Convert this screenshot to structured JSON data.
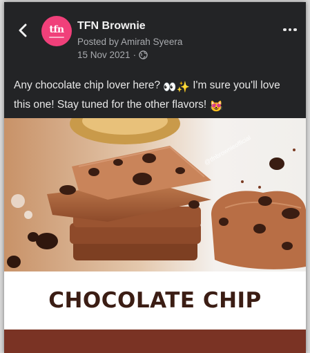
{
  "post": {
    "page_name": "TFN Brownie",
    "avatar_text": "tfn",
    "posted_by": "Posted by Amirah Syeera",
    "date": "15 Nov 2021",
    "date_separator": "·",
    "audience_icon": "globe-icon",
    "caption_part1": "Any chocolate chip lover here? ",
    "caption_emoji1": "👀✨",
    "caption_part2": " I'm sure you'll love this one! Stay tuned for the other flavors! ",
    "caption_emoji2": "😻"
  },
  "image": {
    "watermark": "@tfnbrownieofficial",
    "banner_title": "CHOCOLATE CHIP"
  },
  "colors": {
    "background": "#232426",
    "avatar": "#f0407a",
    "banner_text": "#3b1d14",
    "brown_bar": "#7a3324"
  }
}
